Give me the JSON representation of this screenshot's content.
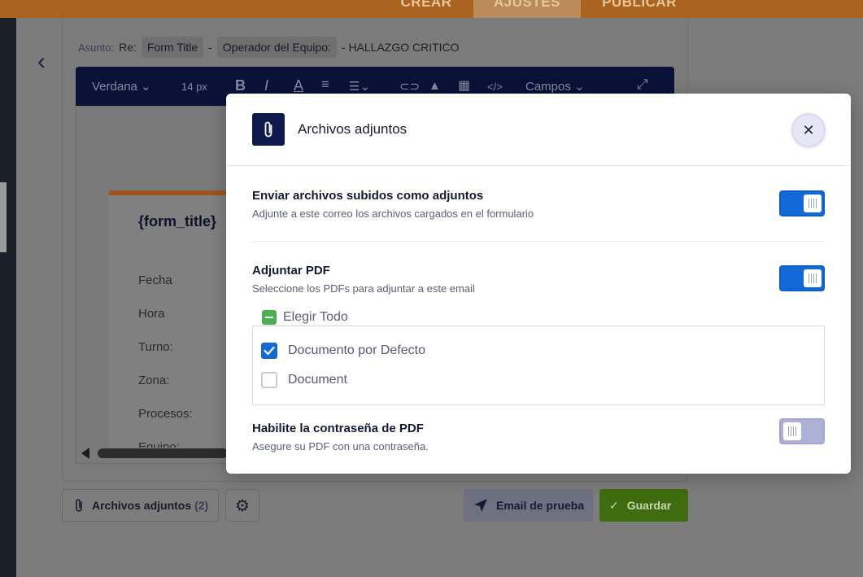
{
  "top_nav": {
    "tabs": [
      {
        "label": "CREAR"
      },
      {
        "label": "AJUSTES"
      },
      {
        "label": "PUBLICAR"
      }
    ]
  },
  "subject": {
    "label": "Asunto:",
    "re": "Re:",
    "chip_form_title": "Form Title",
    "sep1": "-",
    "chip_operator": "Operador del Equipo:",
    "suffix": "- HALLAZGO CRITICO"
  },
  "editor_toolbar": {
    "font": "Verdana",
    "size": "14 px",
    "fields_menu": "Campos"
  },
  "form_preview": {
    "title": "{form_title}",
    "rows": [
      "Fecha",
      "Hora",
      "Turno:",
      "Zona:",
      "Procesos:",
      "Equipo:"
    ]
  },
  "footer": {
    "attachments_label": "Archivos adjuntos",
    "attachments_count": "(2)",
    "test_email_label": "Email de prueba",
    "save_label": "Guardar"
  },
  "modal": {
    "title": "Archivos adjuntos",
    "close_glyph": "✕",
    "send_uploads": {
      "title": "Enviar archivos subidos como adjuntos",
      "description": "Adjunte a este correo los archivos cargados en el formulario",
      "enabled": true
    },
    "attach_pdf": {
      "title": "Adjuntar PDF",
      "description": "Seleccione los PDFs para adjuntar a este email",
      "enabled": true,
      "select_all_label": "Elegir Todo",
      "documents": [
        {
          "label": "Documento por Defecto",
          "checked": true
        },
        {
          "label": "Document",
          "checked": false
        }
      ]
    },
    "pdf_password": {
      "title": "Habilite la contraseña de PDF",
      "description": "Asegure su PDF con una contraseña.",
      "enabled": false
    }
  },
  "colors": {
    "toggle_on": "#1469d8",
    "toggle_off": "#aeb1d6",
    "save_button": "#3f6c0e",
    "modal_icon_bg": "#0e1a4b",
    "select_all_green": "#4caf50"
  }
}
